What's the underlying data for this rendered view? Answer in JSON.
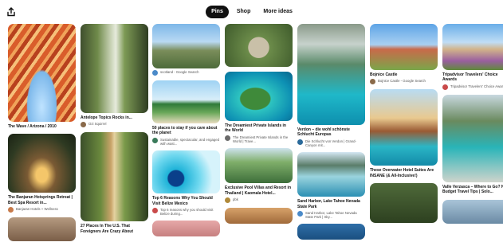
{
  "tabs": [
    {
      "label": "Pins",
      "active": true
    },
    {
      "label": "Shop",
      "active": false
    },
    {
      "label": "More ideas",
      "active": false
    }
  ],
  "columns": [
    [
      {
        "art": "wave",
        "h": 123,
        "title": "The Wave / Arizona / 2010",
        "source": "",
        "avatar": ""
      },
      {
        "art": "cave",
        "h": 74,
        "title": "The Banjaran Hotsprings Retreat | Best Spa Resort in...",
        "source": "Banjaran Hotels + Wellness",
        "avatar": "a1"
      },
      {
        "art": "peek1",
        "h": 30,
        "title": "",
        "source": "",
        "avatar": ""
      }
    ],
    [
      {
        "art": "canyon",
        "h": 112,
        "title": "Antelope Topics Rocks in...",
        "source": "Ozi Squirrel",
        "avatar": "a2"
      },
      {
        "art": "falls",
        "h": 112,
        "title": "27 Places In The U.S. That Foreigners Are Crazy About",
        "source": "",
        "avatar": ""
      }
    ],
    [
      {
        "art": "castle",
        "h": 56,
        "title": "",
        "source": "scotland - Google Search",
        "avatar": "a3"
      },
      {
        "art": "palm",
        "h": 54,
        "title": "50 places to stay if you care about the planet",
        "source": "Sustainable, spectacular, and engaged with wast...",
        "avatar": "a4"
      },
      {
        "art": "blueh",
        "h": 54,
        "title": "Top 6 Reasons Why You Should Visit Belize Mexico",
        "source": "Top 6 reasons why you should visit Belize during...",
        "avatar": "a5"
      },
      {
        "art": "peek2",
        "h": 20,
        "title": "",
        "source": "",
        "avatar": ""
      }
    ],
    [
      {
        "art": "fort",
        "h": 54,
        "title": "",
        "source": "",
        "avatar": ""
      },
      {
        "art": "island",
        "h": 62,
        "title": "The Dreamiest Private Islands in the World",
        "source": "The Dreamiest Private Islands in the World | Trave...",
        "avatar": "a6"
      },
      {
        "art": "villa",
        "h": 44,
        "title": "Exclusive Pool Villas and Resort in Thailand | Kaomala Hotel...",
        "source": "pbk",
        "avatar": "a7"
      },
      {
        "art": "peek3",
        "h": 20,
        "title": "",
        "source": "",
        "avatar": ""
      }
    ],
    [
      {
        "art": "river",
        "h": 127,
        "title": "Verdon – die wohl schönste Schlucht Europas",
        "source": "Die Schlucht von Verdon | Grand-Canyon mit...",
        "avatar": "a8"
      },
      {
        "art": "lake",
        "h": 56,
        "title": "Sand Harbor, Lake Tahoe Nevada State Park",
        "source": "Sand Harbor, Lake Tahoe Nevada State Park | Sky...",
        "avatar": "a3"
      },
      {
        "art": "peek4",
        "h": 20,
        "title": "",
        "source": "",
        "avatar": ""
      }
    ],
    [
      {
        "art": "church",
        "h": 58,
        "title": "Bojnice Castle",
        "source": "Bojnice Castle - Google Search",
        "avatar": "a2"
      },
      {
        "art": "bungalow",
        "h": 96,
        "title": "These Overwater Hotel Suites Are INSANE (& All-Inclusive!)",
        "source": "",
        "avatar": ""
      },
      {
        "art": "peek5",
        "h": 50,
        "title": "",
        "source": "",
        "avatar": ""
      }
    ],
    [
      {
        "art": "trenc",
        "h": 58,
        "title": "Tripadvisor Travelers' Choice Awards",
        "source": "Tripadvisor Travelers' Choice Awards",
        "avatar": "a5"
      },
      {
        "art": "verz",
        "h": 110,
        "title": "Valle Verzasca – Where to Go? Now Budget Travel Tips | Solo...",
        "source": "",
        "avatar": ""
      },
      {
        "art": "peek6",
        "h": 30,
        "title": "",
        "source": "",
        "avatar": ""
      }
    ]
  ]
}
